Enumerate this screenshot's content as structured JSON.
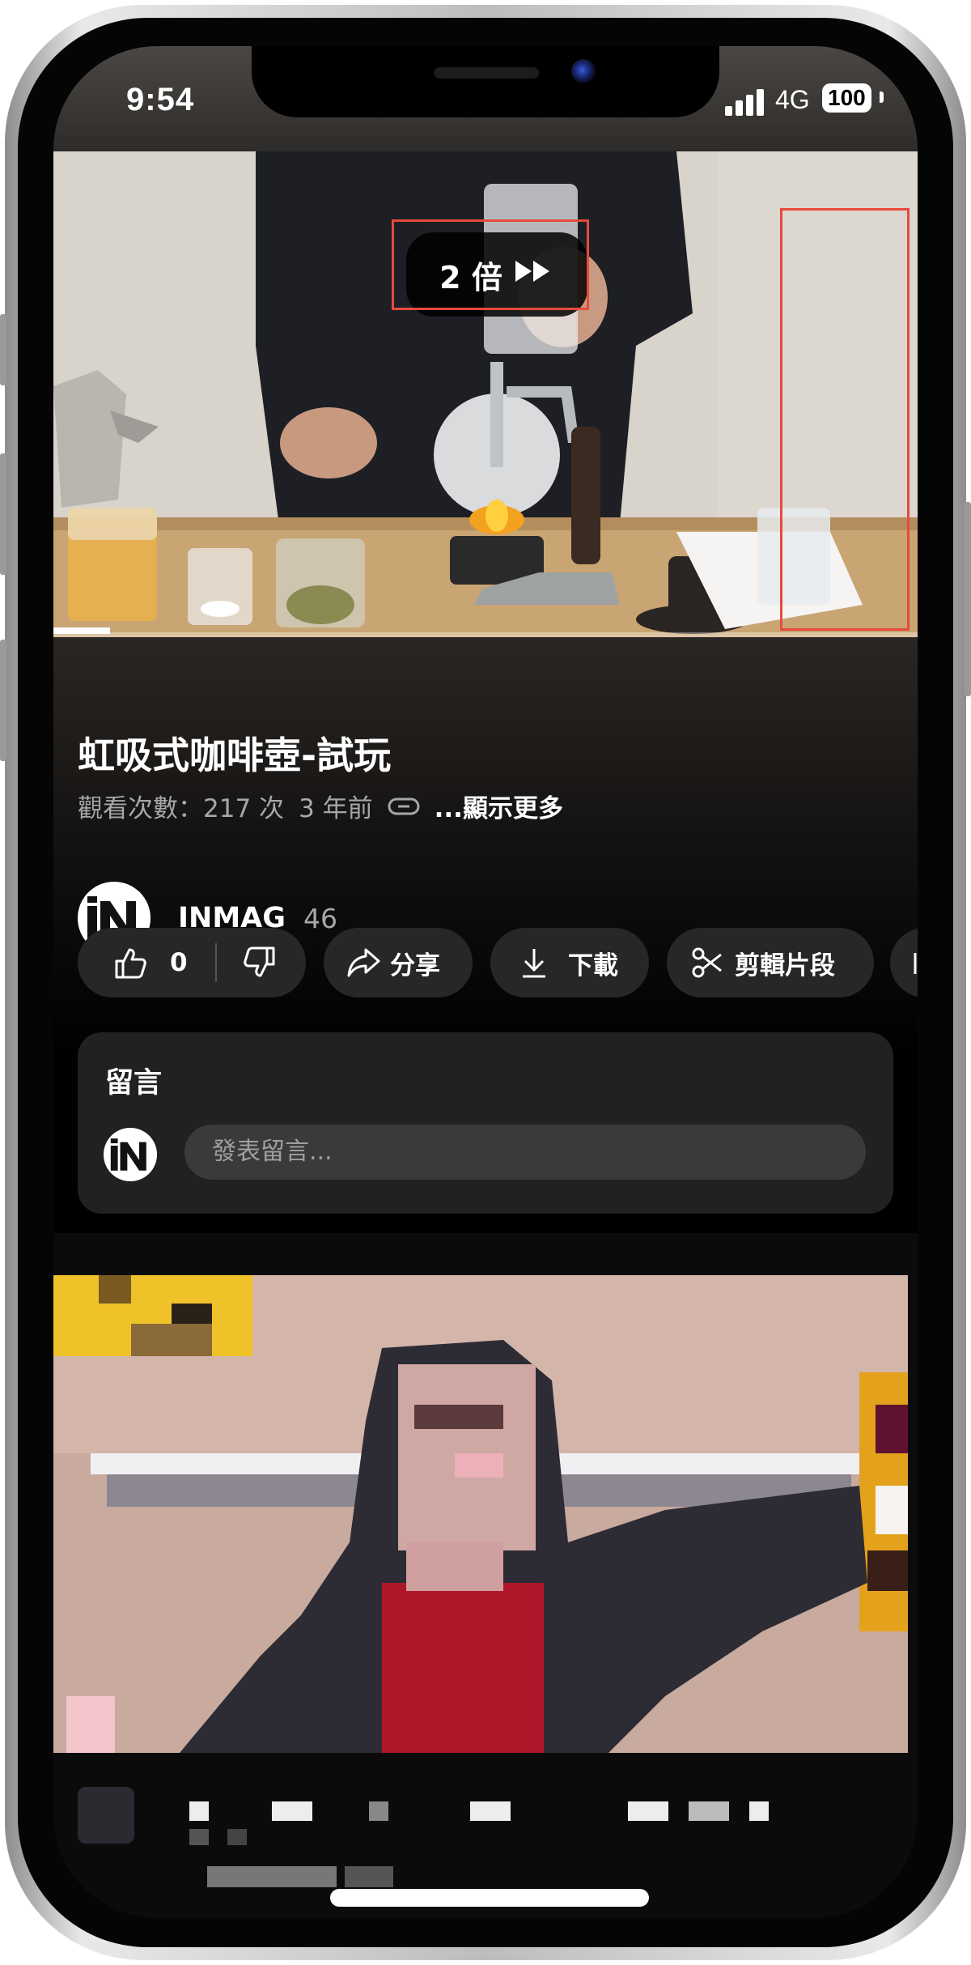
{
  "status_bar": {
    "time": "9:54",
    "network": "4G",
    "battery": "100"
  },
  "video": {
    "playback_speed": "2 倍",
    "speed_icon": "fast-forward-icon",
    "highlight_color": "#e64b3c"
  },
  "info": {
    "title": "虹吸式咖啡壺-試玩",
    "views": "觀看次數：217 次",
    "age": "3 年前",
    "more": "...顯示更多"
  },
  "channel": {
    "name": "INMAG",
    "subscribers": "46",
    "avatar_text": "iN"
  },
  "actions": {
    "like_count": "0",
    "share": "分享",
    "download": "下載",
    "clip": "剪輯片段"
  },
  "comments": {
    "title": "留言",
    "placeholder": "發表留言..."
  }
}
